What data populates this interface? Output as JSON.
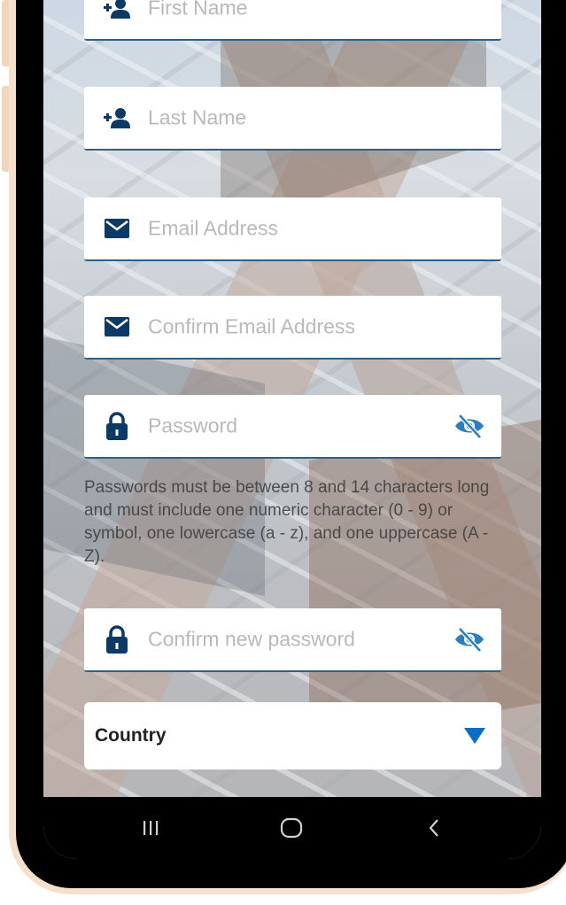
{
  "form": {
    "first_name": {
      "placeholder": "First Name",
      "icon": "add-user-icon"
    },
    "last_name": {
      "placeholder": "Last Name",
      "icon": "add-user-icon"
    },
    "email": {
      "placeholder": "Email Address",
      "icon": "envelope-icon"
    },
    "confirm_email": {
      "placeholder": "Confirm Email Address",
      "icon": "envelope-icon"
    },
    "password": {
      "placeholder": "Password",
      "icon": "lock-icon",
      "toggle_icon": "eye-off-icon"
    },
    "password_hint": "Passwords must be between 8 and 14 characters long and must include one numeric character (0 - 9) or symbol, one lowercase (a - z), and one uppercase (A - Z).",
    "confirm_password": {
      "placeholder": "Confirm new password",
      "icon": "lock-icon",
      "toggle_icon": "eye-off-icon"
    },
    "country": {
      "label": "Country",
      "icon": "caret-down-icon"
    }
  },
  "nav": {
    "recents_icon": "recent-apps-icon",
    "home_icon": "home-icon",
    "back_icon": "back-icon"
  },
  "colors": {
    "icon_navy": "#0c3a66",
    "accent_blue": "#0a6fc2",
    "eye_blue": "#2a7fc1",
    "underline": "#2f5f84",
    "frame_peach": "#f6e0cb"
  }
}
